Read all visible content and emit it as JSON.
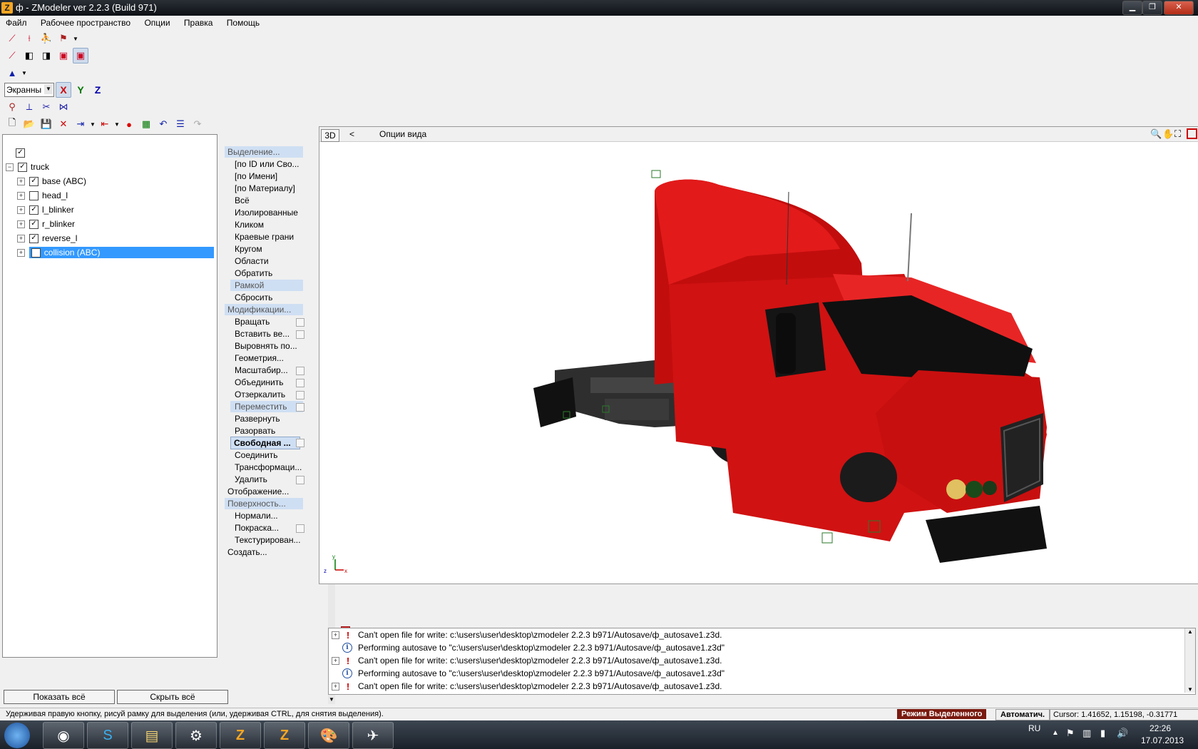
{
  "window": {
    "title": "ф - ZModeler ver 2.2.3 (Build 971)",
    "icon_letter": "Z"
  },
  "menu": [
    "Файл",
    "Рабочее пространство",
    "Опции",
    "Правка",
    "Помощь"
  ],
  "toolbar": {
    "coord_mode": "Экранны",
    "axis_x": "X",
    "axis_y": "Y",
    "axis_z": "Z"
  },
  "tree": {
    "root": "truck",
    "items": [
      {
        "label": "base (ABC)",
        "checked": true
      },
      {
        "label": "head_l",
        "checked": false
      },
      {
        "label": "l_blinker",
        "checked": true
      },
      {
        "label": "r_blinker",
        "checked": true
      },
      {
        "label": "reverse_l",
        "checked": true
      },
      {
        "label": "collision (ABC)",
        "checked": false,
        "selected": true
      }
    ],
    "show_all": "Показать всё",
    "hide_all": "Скрыть всё"
  },
  "commands": {
    "select_header": "Выделение...",
    "select_items": [
      "[по ID или Сво...",
      "[по Имени]",
      "[по Материалу]",
      "Всё",
      "Изолированные",
      "Кликом",
      "Краевые грани",
      "Кругом",
      "Области",
      "Обратить"
    ],
    "select_frame": "Рамкой",
    "select_reset": "Сбросить",
    "modify_header": "Модификации...",
    "modify_items_a": [
      "Вращать",
      "Вставить  ве...",
      "Выровнять по...",
      "Геометрия...",
      "Масштабир...",
      "Объединить",
      "Отзеркалить"
    ],
    "modify_move": "Переместить",
    "modify_items_b": [
      "Развернуть",
      "Разорвать"
    ],
    "modify_free": "Свободная ...",
    "modify_items_c": [
      "Соединить",
      "Трансформаци...",
      "Удалить"
    ],
    "display": "Отображение...",
    "surface_header": "Поверхность...",
    "surface_items": [
      "Нормали...",
      "Покраска...",
      "Текстурирован..."
    ],
    "create": "Создать..."
  },
  "viewport": {
    "mode": "3D",
    "back": "<",
    "title": "Опции вида",
    "body_color": "#d41010"
  },
  "log": [
    {
      "type": "error",
      "text": "Can't open file for write: c:\\users\\user\\desktop\\zmodeler 2.2.3 b971/Autosave/ф_autosave1.z3d."
    },
    {
      "type": "info",
      "text": "Performing autosave to \"c:\\users\\user\\desktop\\zmodeler 2.2.3 b971/Autosave/ф_autosave1.z3d\""
    },
    {
      "type": "error",
      "text": "Can't open file for write: c:\\users\\user\\desktop\\zmodeler 2.2.3 b971/Autosave/ф_autosave1.z3d."
    },
    {
      "type": "info",
      "text": "Performing autosave to \"c:\\users\\user\\desktop\\zmodeler 2.2.3 b971/Autosave/ф_autosave1.z3d\""
    },
    {
      "type": "error",
      "text": "Can't open file for write: c:\\users\\user\\desktop\\zmodeler 2.2.3 b971/Autosave/ф_autosave1.z3d."
    }
  ],
  "status": {
    "hint": "Удерживая правую кнопку, рисуй рамку для выделения (или, удерживая CTRL, для снятия выделения).",
    "mode": "Режим Выделенного",
    "auto": "Автоматич.",
    "cursor": "Cursor: 1.41652, 1.15198, -0.31771"
  },
  "taskbar": {
    "lang": "RU",
    "time": "22:26",
    "date": "17.07.2013"
  }
}
